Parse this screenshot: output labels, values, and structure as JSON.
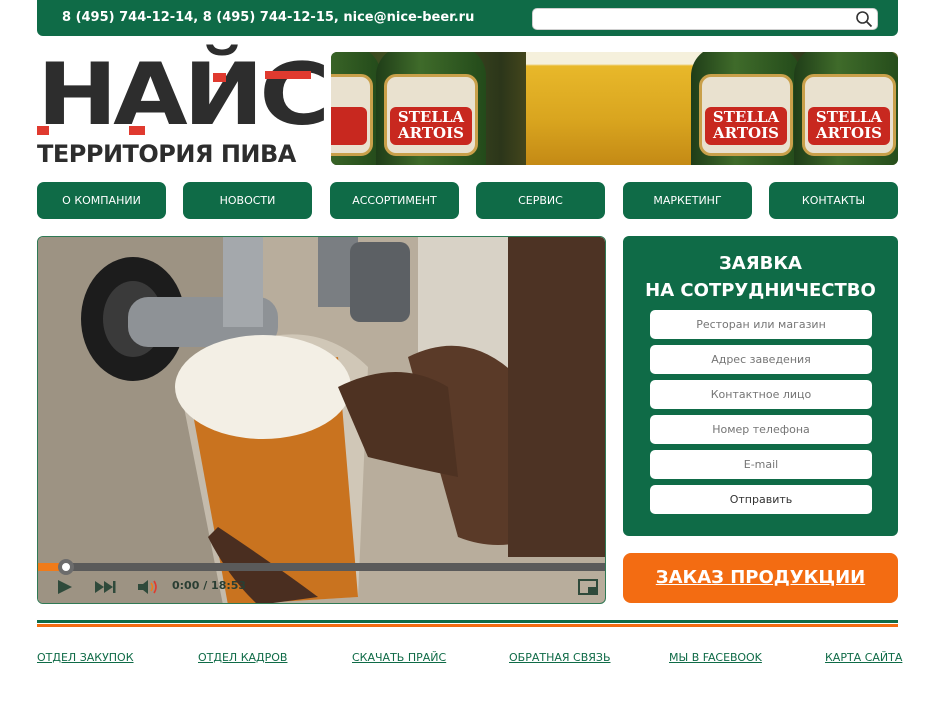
{
  "header": {
    "contacts": "8 (495) 744-12-14, 8 (495) 744-12-15, nice@nice-beer.ru",
    "search_placeholder": "",
    "search_icon": "search-icon"
  },
  "logo": {
    "name": "НАЙС",
    "tagline": "ТЕРРИТОРИЯ ПИВА"
  },
  "banner": {
    "bottle_text": [
      "STELLA\nARTOIS",
      "STELLA\nARTOIS",
      "STELLA\nARTOIS"
    ]
  },
  "nav": [
    {
      "label": "О КОМПАНИИ"
    },
    {
      "label": "НОВОСТИ"
    },
    {
      "label": "АССОРТИМЕНТ"
    },
    {
      "label": "СЕРВИС"
    },
    {
      "label": "МАРКЕТИНГ"
    },
    {
      "label": "КОНТАКТЫ"
    }
  ],
  "video": {
    "time": "0:00 / 18:53",
    "progress": 0.05,
    "icons": [
      "play-icon",
      "skip-forward-icon",
      "volume-icon",
      "fullscreen-icon"
    ]
  },
  "form": {
    "title_line1": "ЗАЯВКА",
    "title_line2": "НА СОТРУДНИЧЕСТВО",
    "fields": [
      {
        "placeholder": "Ресторан или магазин"
      },
      {
        "placeholder": "Адрес заведения"
      },
      {
        "placeholder": "Контактное лицо"
      },
      {
        "placeholder": "Номер телефона"
      },
      {
        "placeholder": "E-mail"
      }
    ],
    "submit": "Отправить"
  },
  "order_button": "ЗАКАЗ ПРОДУКЦИИ",
  "footer": [
    {
      "label": "ОТДЕЛ ЗАКУПОК"
    },
    {
      "label": "ОТДЕЛ КАДРОВ"
    },
    {
      "label": "СКАЧАТЬ ПРАЙС"
    },
    {
      "label": "ОБРАТНАЯ СВЯЗЬ"
    },
    {
      "label": "МЫ В FACEBOOK"
    },
    {
      "label": "КАРТА САЙТА"
    }
  ],
  "colors": {
    "brand_green": "#0f6b47",
    "accent_orange": "#f36c12",
    "logo_red": "#e03a2f"
  }
}
